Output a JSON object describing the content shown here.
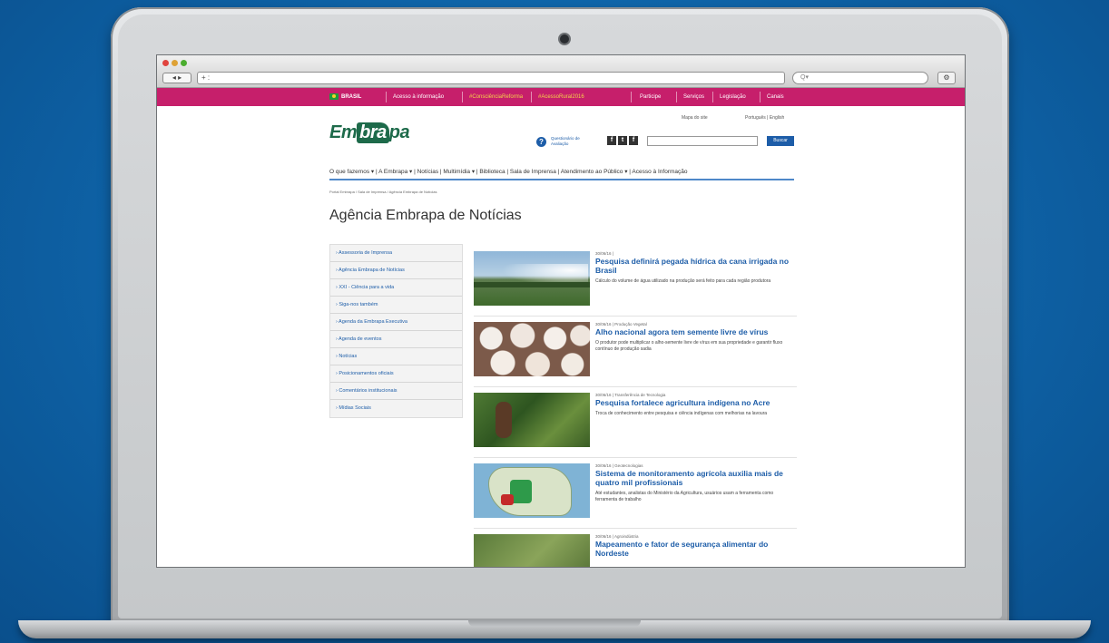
{
  "browser": {
    "back_forward": "◂ ▸",
    "url": "+ :",
    "search_placeholder": "Q▾",
    "right_button": "⚙"
  },
  "gov_bar": {
    "brasil": "BRASIL",
    "links": [
      "Acesso à informação",
      "#ConsciênciaReforma",
      "#AcessoRural2016",
      "Participe",
      "Serviços",
      "Legislação",
      "Canais"
    ]
  },
  "site": {
    "logo_prefix": "Em",
    "logo_mark": "bra",
    "logo_suffix": "pa",
    "util_left": "Mapa do site",
    "util_right": "Português | English",
    "help_text": "Questionário de Avaliação",
    "social": [
      "f",
      "t",
      "f"
    ],
    "search_button": "Buscar",
    "nav": "O que fazemos  ▾ | A Embrapa ▾ | Notícias | Multimídia ▾ | Biblioteca | Sala de Imprensa | Atendimento ao Público ▾ | Acesso à Informação",
    "breadcrumb": "Portal Embrapa / Sala de Imprensa / Agência Embrapa de Notícias",
    "page_title": "Agência Embrapa de Notícias",
    "side_menu": [
      "› Assessoria de Imprensa",
      "› Agência Embrapa de Notícias",
      "› XXI - Ciência para a vida",
      "› Siga-nos também",
      "› Agenda da Embrapa Executiva",
      "› Agenda de eventos",
      "› Notícias",
      "› Posicionamentos oficiais",
      "› Comentários institucionais",
      "› Mídias Sociais"
    ],
    "news": [
      {
        "tag": "30/06/16  |",
        "headline": "Pesquisa definirá pegada hídrica da cana irrigada no Brasil",
        "summary": "Cálculo do volume de água utilizado na produção será feito para cada região produtora"
      },
      {
        "tag": "30/06/16  |  Produção Vegetal",
        "headline": "Alho nacional agora tem semente livre de vírus",
        "summary": "O produtor pode multiplicar o alho-semente livre de vírus em sua propriedade e garantir fluxo contínuo de produção sadia"
      },
      {
        "tag": "30/06/16  |  Transferência de Tecnologia",
        "headline": "Pesquisa fortalece agricultura indígena no Acre",
        "summary": "Troca de conhecimento entre pesquisa e ciência indígenas com melhorias na lavoura"
      },
      {
        "tag": "30/06/16  |  Geotecnologias",
        "headline": "Sistema de monitoramento agrícola auxilia mais de quatro mil profissionais",
        "summary": "Até estudantes, analistas do Ministério da Agricultura, usuários usam a ferramenta como ferramenta de trabalho"
      },
      {
        "tag": "30/06/16  |  Agroindústria",
        "headline": "Mapeamento e fator de segurança alimentar do Nordeste",
        "summary": ""
      }
    ]
  },
  "colors": {
    "gov_bar": "#c61f6b",
    "link_blue": "#1d5da8",
    "logo_green": "#1d6a4a",
    "background_blue": "#0e62a6"
  }
}
